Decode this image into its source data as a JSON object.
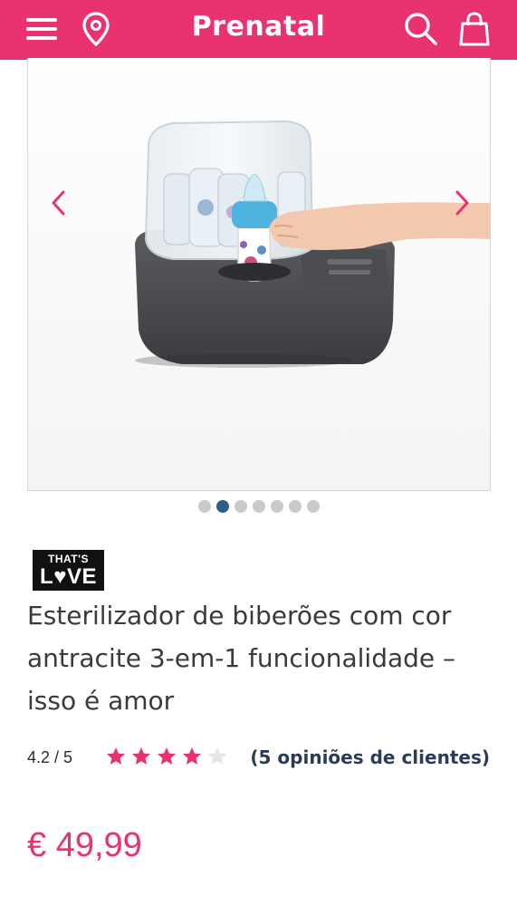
{
  "header": {
    "logo": "Prenatal",
    "accent_color": "#e8336e",
    "icons": [
      "menu-icon",
      "location-pin-icon",
      "search-icon",
      "shopping-bag-icon"
    ]
  },
  "gallery": {
    "image": "product-photo",
    "dots_count": 7,
    "active_dot": 2,
    "active_dot_color": "#2d5f8a"
  },
  "product": {
    "brand_line1": "THAT'S",
    "brand_line2_before": "L",
    "brand_line2_heart": "♥",
    "brand_line2_after": "VE",
    "title": "Esterilizador de biberões com cor antracite 3-em-1 funcionalidade – isso é amor",
    "rating": "4.2 / 5",
    "stars_filled": 4,
    "stars_total": 5,
    "reviews": "(5 opiniões de clientes)",
    "price": "€ 49,99",
    "price_color": "#e8336e"
  }
}
